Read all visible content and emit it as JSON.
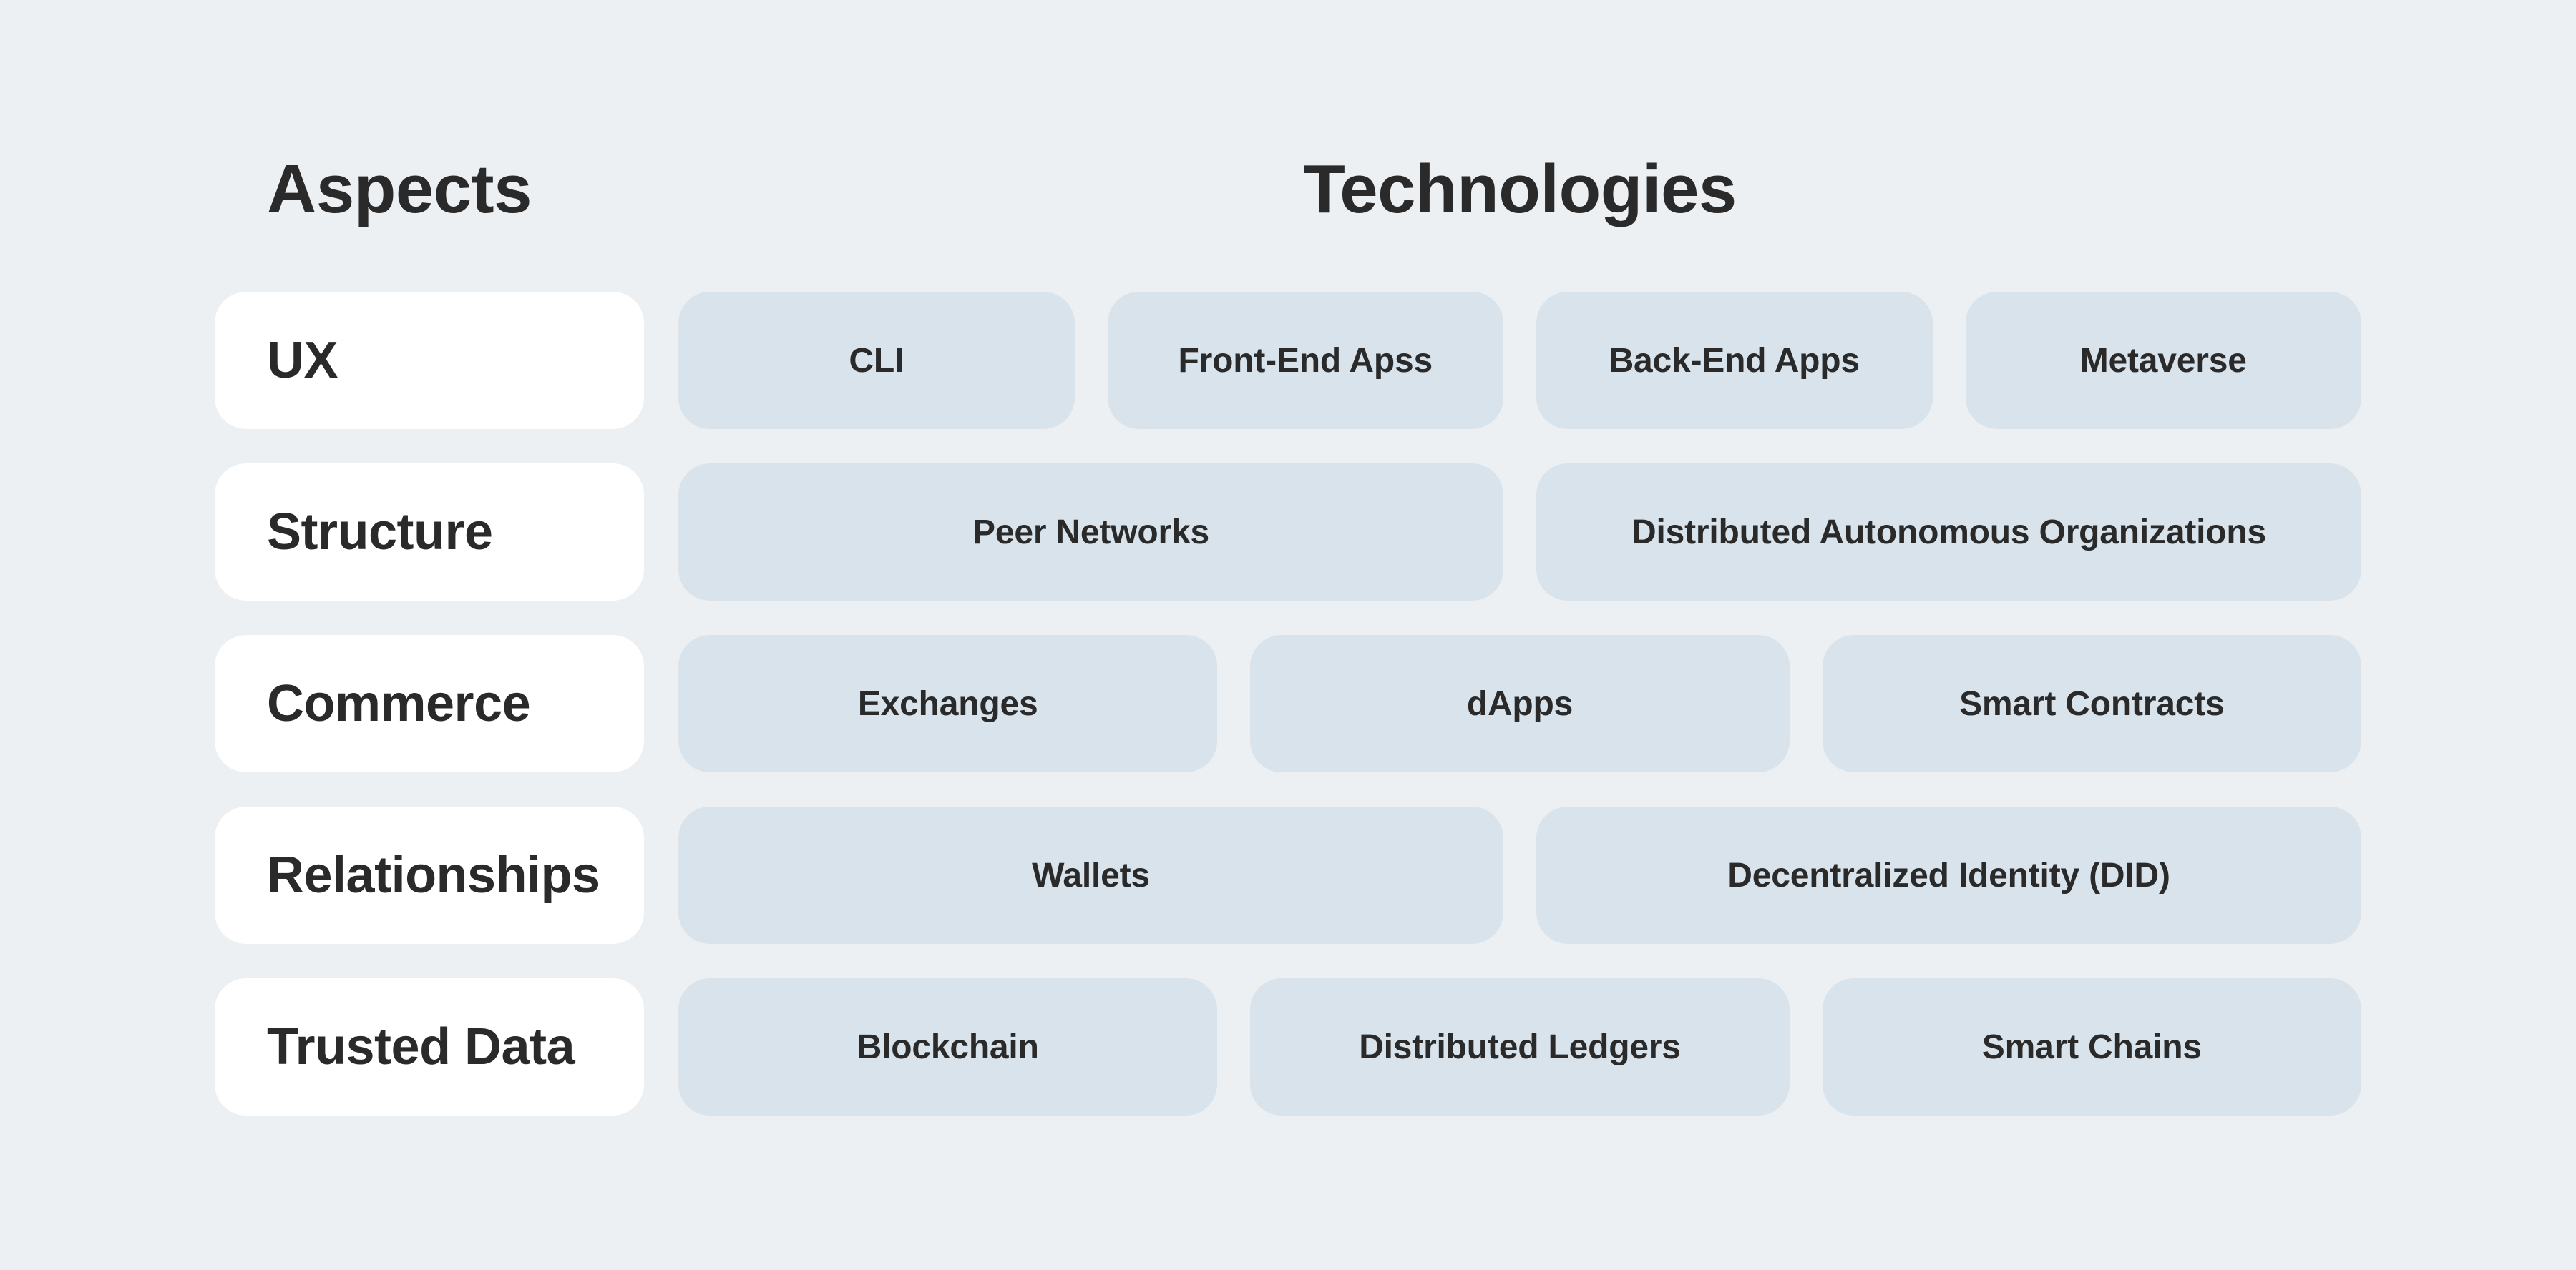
{
  "headers": {
    "aspects": "Aspects",
    "technologies": "Technologies"
  },
  "colors": {
    "background": "#ECF0F3",
    "aspect_cell": "#FFFFFF",
    "tech_cell": "#D9E3EB",
    "text": "#2A2A2A"
  },
  "rows": [
    {
      "aspect": "UX",
      "technologies": [
        "CLI",
        "Front-End Apss",
        "Back-End Apps",
        "Metaverse"
      ]
    },
    {
      "aspect": "Structure",
      "technologies": [
        "Peer Networks",
        "Distributed Autonomous Organizations"
      ]
    },
    {
      "aspect": "Commerce",
      "technologies": [
        "Exchanges",
        "dApps",
        "Smart Contracts"
      ]
    },
    {
      "aspect": "Relationships",
      "technologies": [
        "Wallets",
        "Decentralized Identity (DID)"
      ]
    },
    {
      "aspect": "Trusted Data",
      "technologies": [
        "Blockchain",
        "Distributed Ledgers",
        "Smart Chains"
      ]
    }
  ]
}
